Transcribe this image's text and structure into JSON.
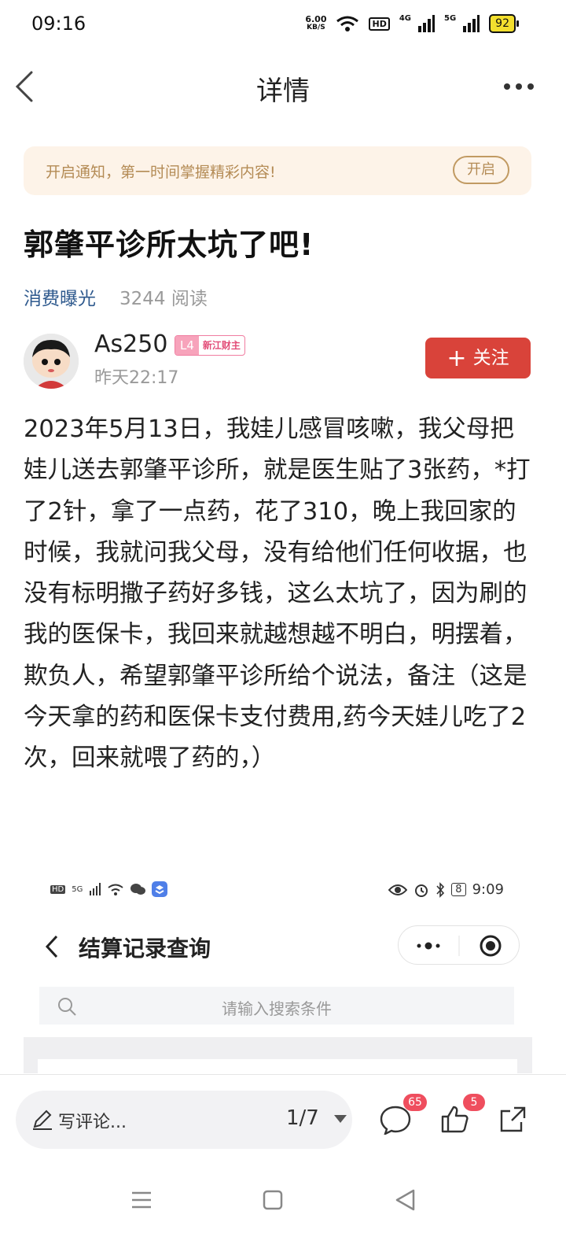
{
  "status_bar": {
    "time": "09:16",
    "net_speed_value": "6.00",
    "net_speed_unit": "KB/S",
    "hd_label": "HD",
    "signal_1_label": "4G",
    "signal_2_label": "5G",
    "battery": "92"
  },
  "nav": {
    "title": "详情"
  },
  "notify": {
    "text": "开启通知，第一时间掌握精彩内容!",
    "button": "开启"
  },
  "post": {
    "title": "郭肇平诊所太坑了吧!",
    "category": "消费曝光",
    "reads": "3244 阅读",
    "author": {
      "name": "As250",
      "level": "L4",
      "honor": "新江财主",
      "time": "昨天22:17"
    },
    "follow_label": "关注",
    "body": "2023年5月13日，我娃儿感冒咳嗽，我父母把娃儿送去郭肇平诊所，就是医生贴了3张药，*打了2针，拿了一点药，花了310，晚上我回家的时候，我就问我父母，没有给他们任何收据，也没有标明撒子药好多钱，这么太坑了，因为刷的我的医保卡，我回来就越想越不明白，明摆着，欺负人，希望郭肇平诊所给个说法，备注（这是今天拿的药和医保卡支付费用,药今天娃儿吃了2次，回来就喂了药的，）"
  },
  "embedded_screenshot": {
    "status_left_hd": "HD",
    "status_left_signal": "5G",
    "status_battery": "8",
    "status_time": "9:09",
    "title": "结算记录查询",
    "search_placeholder": "请输入搜索条件"
  },
  "bottom_bar": {
    "comment_placeholder": "写评论...",
    "page_indicator": "1/7",
    "comment_count": "65",
    "like_count": "5"
  },
  "colors": {
    "accent_red": "#d9433a",
    "banner_bg": "#fdf3e8",
    "category_blue": "#2f5a8e",
    "badge_red": "#ef4e5e"
  }
}
